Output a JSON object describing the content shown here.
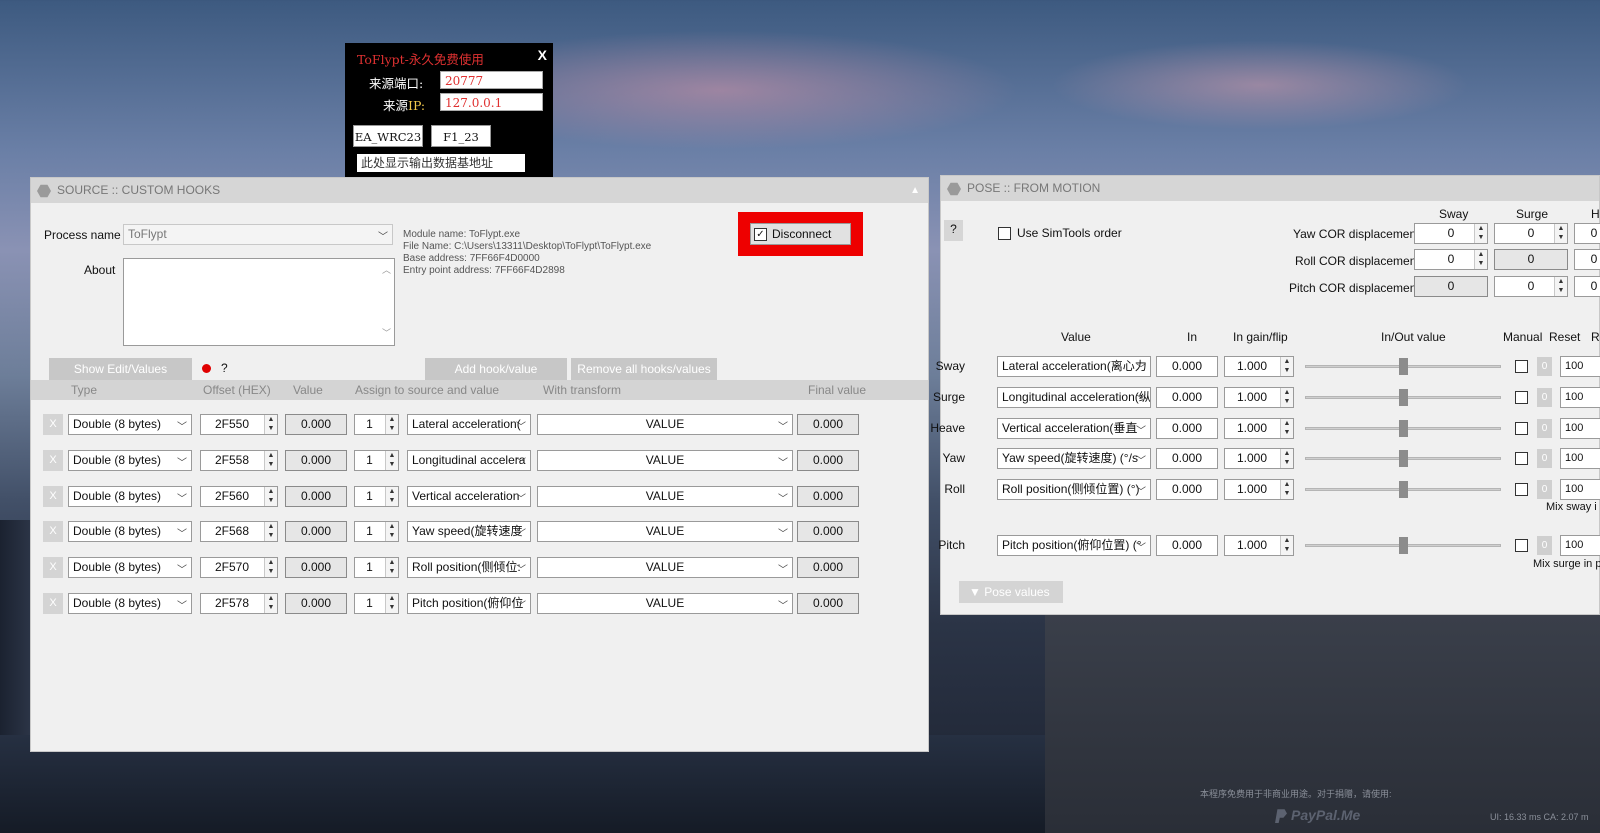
{
  "tool_window": {
    "title": "ToFlypt-永久免费使用",
    "close": "X",
    "port_label": "来源端口:",
    "port_value": "20777",
    "ip_label_prefix": "来源",
    "ip_label_suffix": "IP:",
    "ip_value": "127.0.0.1",
    "btn_ea": "EA_WRC23",
    "btn_f1": "F1_23",
    "address_text": "此处显示输出数据基地址"
  },
  "source_panel": {
    "title": "SOURCE :: CUSTOM HOOKS",
    "collapse_icon": "▲",
    "process_label": "Process name",
    "process_value": "ToFlypt",
    "about_label": "About",
    "module_name": "Module name: ToFlypt.exe",
    "file_name": "File Name: C:\\Users\\13311\\Desktop\\ToFlypt\\ToFlypt.exe",
    "base_address": "Base address: 7FF66F4D0000",
    "entry_point": "Entry point address: 7FF66F4D2898",
    "disconnect_label": "Disconnect",
    "disconnect_checked": true,
    "tab_show_edit": "Show Edit/Values",
    "help": "?",
    "tab_add_hook": "Add hook/value",
    "tab_remove_all": "Remove all hooks/values",
    "columns": [
      "Type",
      "Offset (HEX)",
      "Value",
      "Assign to source and value",
      "With transform",
      "Final value"
    ],
    "rows": [
      {
        "x": "X",
        "type": "Double (8 bytes)",
        "offset": "2F550",
        "value": "0.000",
        "idx": "1",
        "assign": "Lateral acceleration(",
        "transform": "VALUE",
        "final": "0.000"
      },
      {
        "x": "X",
        "type": "Double (8 bytes)",
        "offset": "2F558",
        "value": "0.000",
        "idx": "1",
        "assign": "Longitudinal accelera",
        "transform": "VALUE",
        "final": "0.000"
      },
      {
        "x": "X",
        "type": "Double (8 bytes)",
        "offset": "2F560",
        "value": "0.000",
        "idx": "1",
        "assign": "Vertical acceleration",
        "transform": "VALUE",
        "final": "0.000"
      },
      {
        "x": "X",
        "type": "Double (8 bytes)",
        "offset": "2F568",
        "value": "0.000",
        "idx": "1",
        "assign": "Yaw speed(旋转速度",
        "transform": "VALUE",
        "final": "0.000"
      },
      {
        "x": "X",
        "type": "Double (8 bytes)",
        "offset": "2F570",
        "value": "0.000",
        "idx": "1",
        "assign": "Roll position(侧倾位:",
        "transform": "VALUE",
        "final": "0.000"
      },
      {
        "x": "X",
        "type": "Double (8 bytes)",
        "offset": "2F578",
        "value": "0.000",
        "idx": "1",
        "assign": "Pitch position(俯仰位",
        "transform": "VALUE",
        "final": "0.000"
      }
    ]
  },
  "pose_panel": {
    "title": "POSE :: FROM MOTION",
    "help": "?",
    "use_simtools": "Use SimTools order",
    "col_sway": "Sway",
    "col_surge": "Surge",
    "col_heave": "He",
    "yaw_cor": "Yaw COR displacement",
    "roll_cor": "Roll COR displacement",
    "pitch_cor": "Pitch COR displacement",
    "yaw_cor_values": [
      "0",
      "0",
      "0"
    ],
    "roll_cor_values": [
      "0",
      "0",
      "0"
    ],
    "pitch_cor_values": [
      "0",
      "0",
      "0"
    ],
    "hdr_value": "Value",
    "hdr_in": "In",
    "hdr_gain": "In gain/flip",
    "hdr_inout": "In/Out value",
    "hdr_manual": "Manual",
    "hdr_reset": "Reset",
    "hdr_ra": "Ra",
    "rows": [
      {
        "label": "Sway",
        "source": "Lateral acceleration(离心力",
        "in": "0.000",
        "gain": "1.000",
        "reset": "0",
        "ra": "100"
      },
      {
        "label": "Surge",
        "source": "Longitudinal acceleration(纵",
        "in": "0.000",
        "gain": "1.000",
        "reset": "0",
        "ra": "100"
      },
      {
        "label": "Heave",
        "source": "Vertical acceleration(垂直",
        "in": "0.000",
        "gain": "1.000",
        "reset": "0",
        "ra": "100"
      },
      {
        "label": "Yaw",
        "source": "Yaw speed(旋转速度) (°/s",
        "in": "0.000",
        "gain": "1.000",
        "reset": "0",
        "ra": "100"
      },
      {
        "label": "Roll",
        "source": "Roll position(侧倾位置) (°)",
        "in": "0.000",
        "gain": "1.000",
        "reset": "0",
        "ra": "100"
      },
      {
        "label": "Pitch",
        "source": "Pitch position(俯仰位置) (°",
        "in": "0.000",
        "gain": "1.000",
        "reset": "0",
        "ra": "100"
      }
    ],
    "mix_sway": "Mix sway i",
    "mix_surge": "Mix surge in p",
    "pose_values_tab": "▼   Pose values"
  },
  "footer": {
    "notice": "本程序免费用于非商业用途。对于捐赠，请使用:",
    "paypal": "PayPal.Me",
    "stats": "UI: 16.33 ms  CA: 2.07 m"
  }
}
